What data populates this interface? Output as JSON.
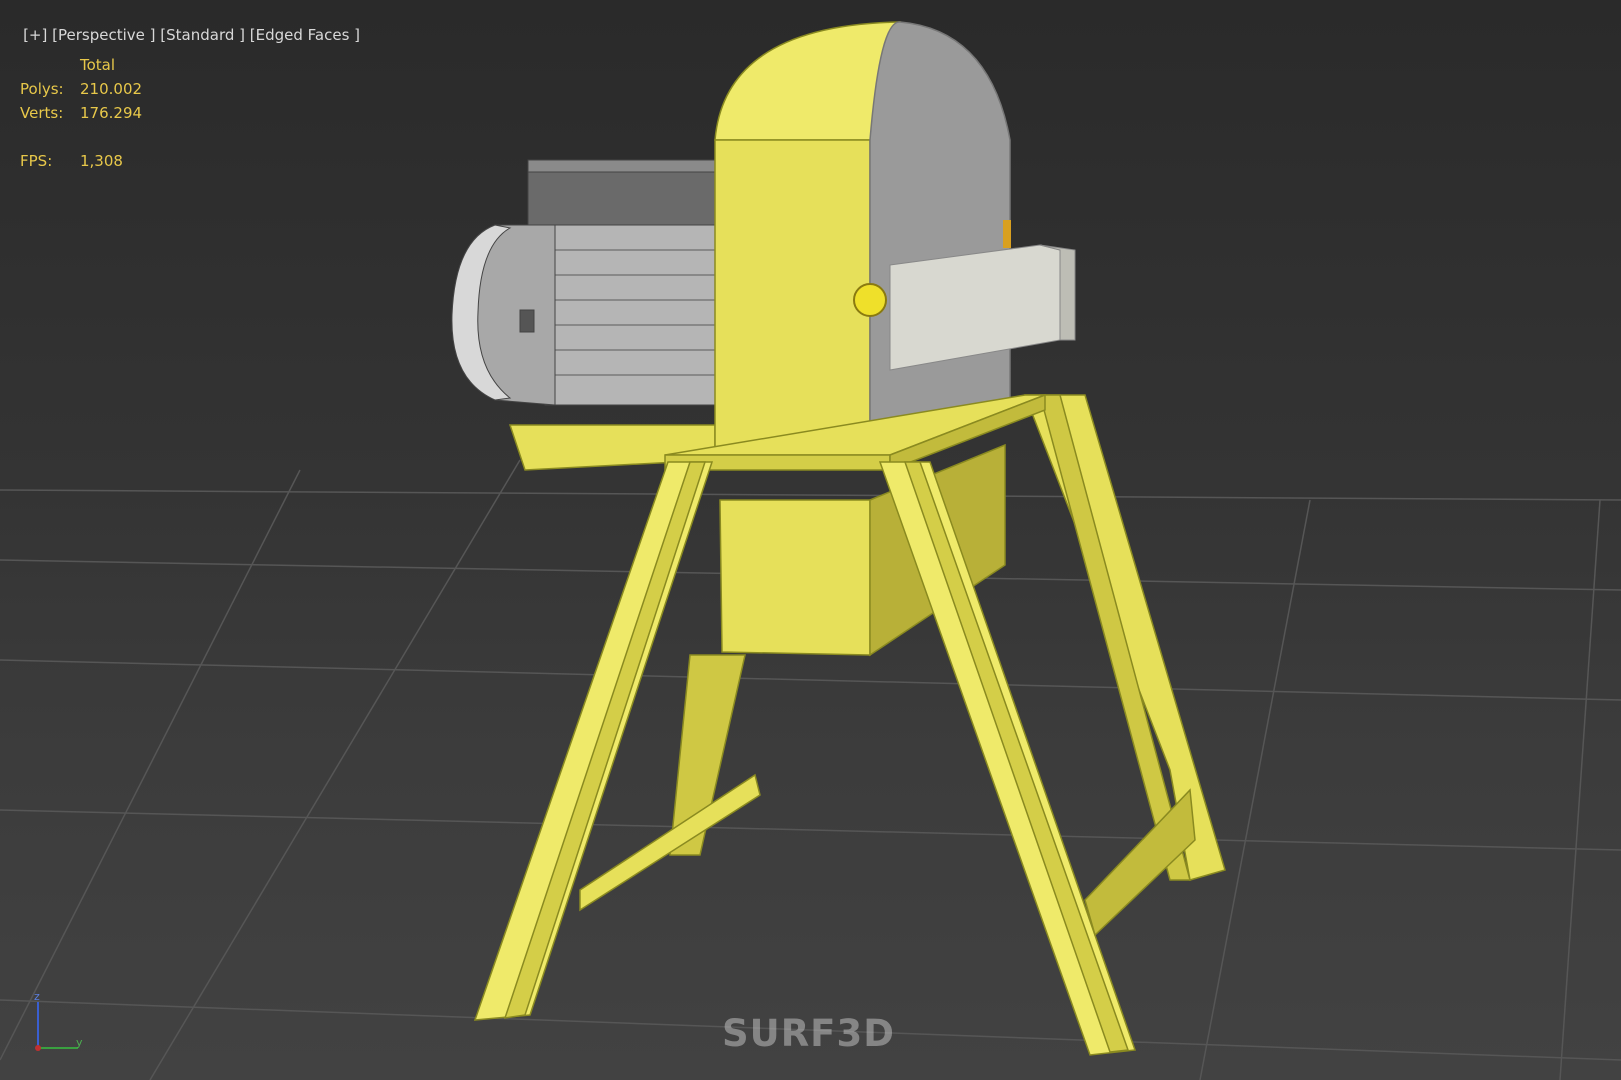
{
  "viewport": {
    "menu_plus": "[+]",
    "menu_view": "[Perspective ]",
    "menu_shading": "[Standard ]",
    "menu_edges": "[Edged Faces ]"
  },
  "stats": {
    "header": "Total",
    "polys_label": "Polys:",
    "polys_value": "210.002",
    "verts_label": "Verts:",
    "verts_value": "176.294",
    "fps_label": "FPS:",
    "fps_value": "1,308"
  },
  "gizmo": {
    "z": "z",
    "y": "y"
  },
  "watermark": "SURF3D",
  "colors": {
    "stat_text": "#e8c84a",
    "model_yellow": "#e6e05a",
    "model_grey": "#9a9a9a",
    "grid_line": "#555555"
  }
}
